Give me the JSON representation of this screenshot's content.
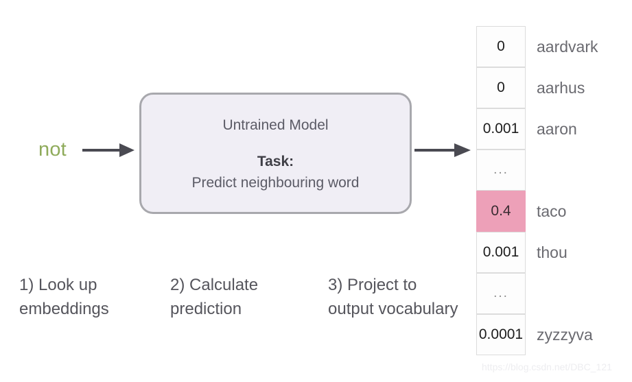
{
  "diagram": {
    "input_word": "not",
    "model": {
      "title": "Untrained Model",
      "task_label": "Task:",
      "task_text": "Predict neighbouring word"
    },
    "steps": [
      {
        "number": "1)",
        "text": "1) Look up embeddings"
      },
      {
        "number": "2)",
        "text": "2) Calculate prediction"
      },
      {
        "number": "3)",
        "text": "3) Project to output vocabulary"
      }
    ],
    "arrows": [
      {
        "name": "input-to-model-arrow",
        "color": "#4a4a52"
      },
      {
        "name": "model-to-output-arrow",
        "color": "#4a4a52"
      }
    ],
    "output_vocabulary": {
      "rows": [
        {
          "value": "0",
          "word": "aardvark",
          "highlighted": false
        },
        {
          "value": "0",
          "word": "aarhus",
          "highlighted": false
        },
        {
          "value": "0.001",
          "word": "aaron",
          "highlighted": false
        },
        {
          "value": "...",
          "word": "",
          "highlighted": false
        },
        {
          "value": "0.4",
          "word": "taco",
          "highlighted": true
        },
        {
          "value": "0.001",
          "word": "thou",
          "highlighted": false
        },
        {
          "value": "...",
          "word": "",
          "highlighted": false
        },
        {
          "value": "0.0001",
          "word": "zyzzyva",
          "highlighted": false
        }
      ],
      "highlight_color": "#eda0b8"
    },
    "watermark": "https://blog.csdn.net/DBC_121",
    "colors": {
      "input_word": "#8fab5b",
      "model_fill": "#f0eef5",
      "model_border": "#a8a8ad",
      "text": "#55555c",
      "highlight": "#eda0b8",
      "background": "#ffffff"
    }
  }
}
